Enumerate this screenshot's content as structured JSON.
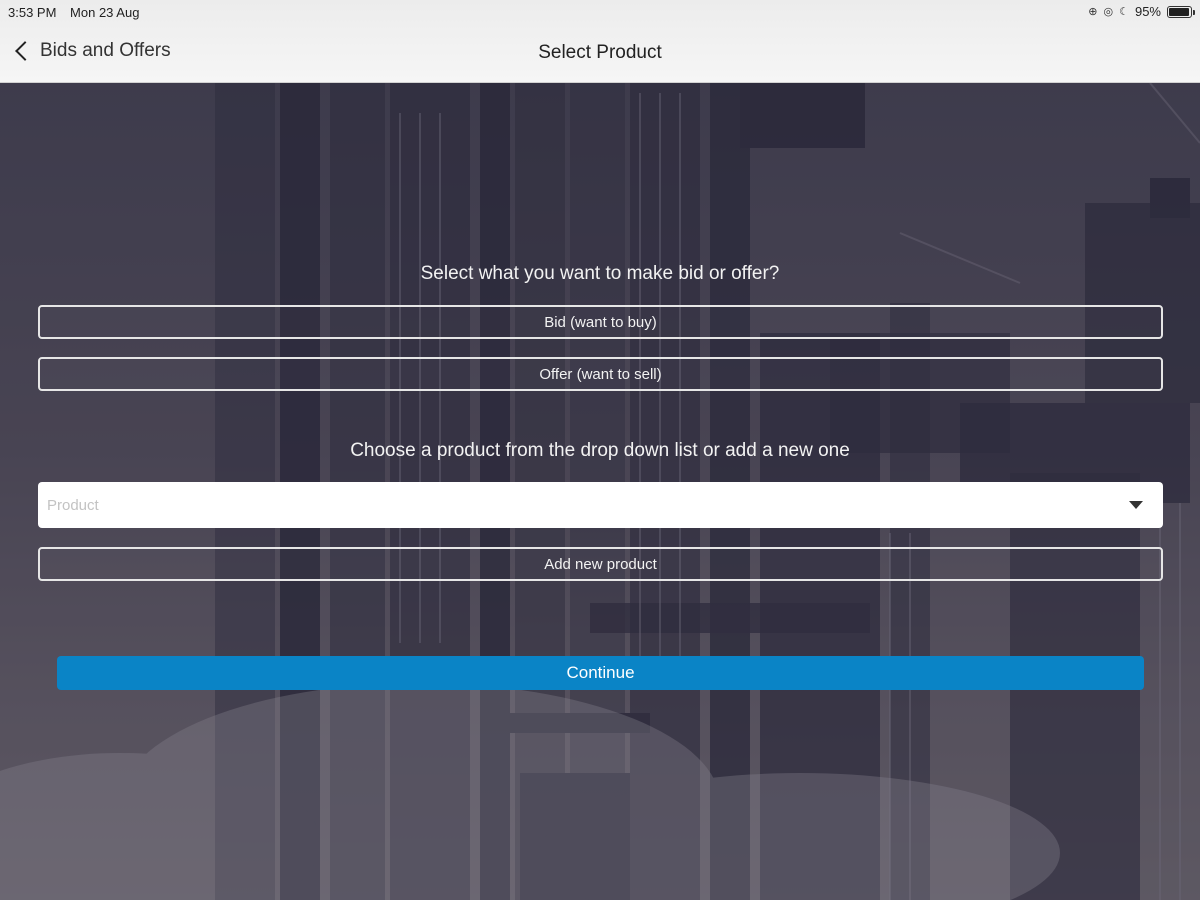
{
  "status_bar": {
    "time": "3:53 PM",
    "date": "Mon 23 Aug",
    "battery_percent": "95%",
    "battery_level": 0.95,
    "icons": [
      "link-icon",
      "location-icon",
      "moon-icon",
      "battery-icon"
    ]
  },
  "nav": {
    "back_label": "Bids and Offers",
    "title": "Select Product"
  },
  "form": {
    "type_prompt": "Select what you want to make bid or offer?",
    "bid_label": "Bid (want to buy)",
    "offer_label": "Offer (want to sell)",
    "product_prompt": "Choose a product from the drop down list or add a new one",
    "product_placeholder": "Product",
    "add_product_label": "Add new product",
    "continue_label": "Continue"
  },
  "colors": {
    "accent": "#0a84c6",
    "outline": "#e6e6e6",
    "topbar": "#f2f2f2"
  }
}
